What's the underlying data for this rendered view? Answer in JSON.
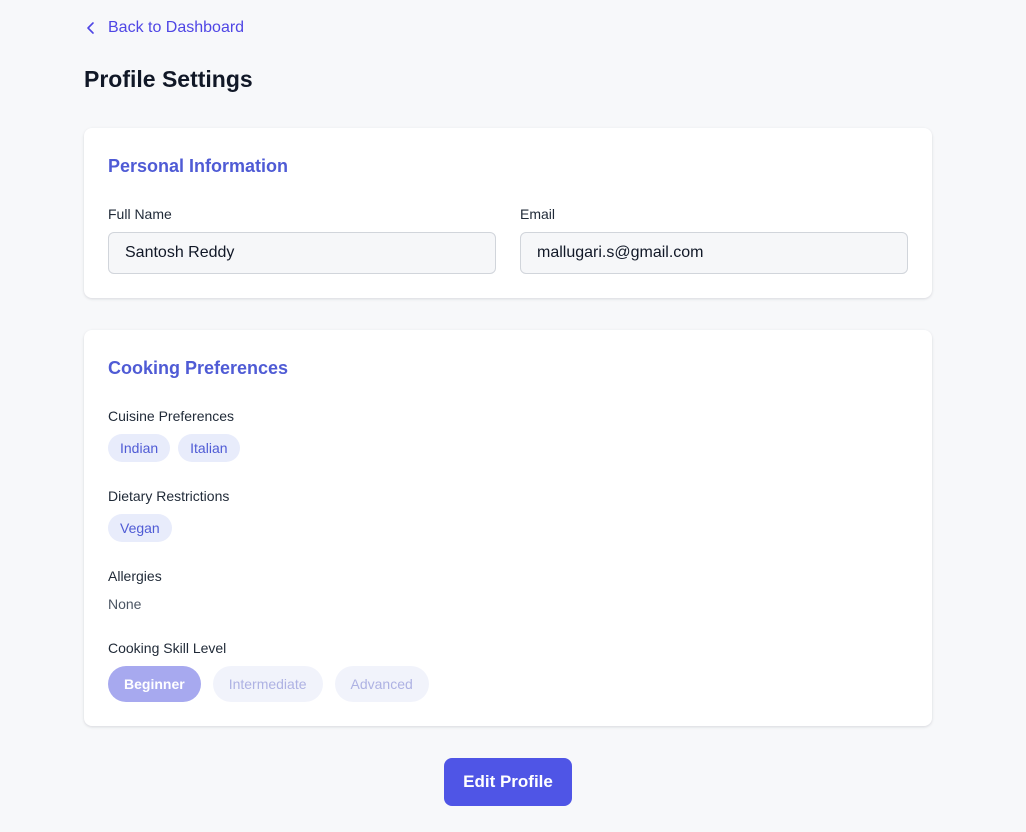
{
  "nav": {
    "back_label": "Back to Dashboard"
  },
  "page": {
    "title": "Profile Settings"
  },
  "personal": {
    "title": "Personal Information",
    "full_name_label": "Full Name",
    "full_name_value": "Santosh Reddy",
    "email_label": "Email",
    "email_value": "mallugari.s@gmail.com"
  },
  "cooking": {
    "title": "Cooking Preferences",
    "cuisine_label": "Cuisine Preferences",
    "cuisines": [
      "Indian",
      "Italian"
    ],
    "dietary_label": "Dietary Restrictions",
    "dietary": [
      "Vegan"
    ],
    "allergies_label": "Allergies",
    "allergies_value": "None",
    "skill_label": "Cooking Skill Level",
    "skills": [
      {
        "label": "Beginner",
        "selected": true
      },
      {
        "label": "Intermediate",
        "selected": false
      },
      {
        "label": "Advanced",
        "selected": false
      }
    ]
  },
  "actions": {
    "edit_label": "Edit Profile"
  },
  "colors": {
    "accent": "#4f55e6",
    "section_title": "#4f5bd5",
    "chip_bg": "#e8ecfb",
    "background": "#f7f8fa"
  },
  "icons": {
    "back": "chevron-left-icon"
  }
}
